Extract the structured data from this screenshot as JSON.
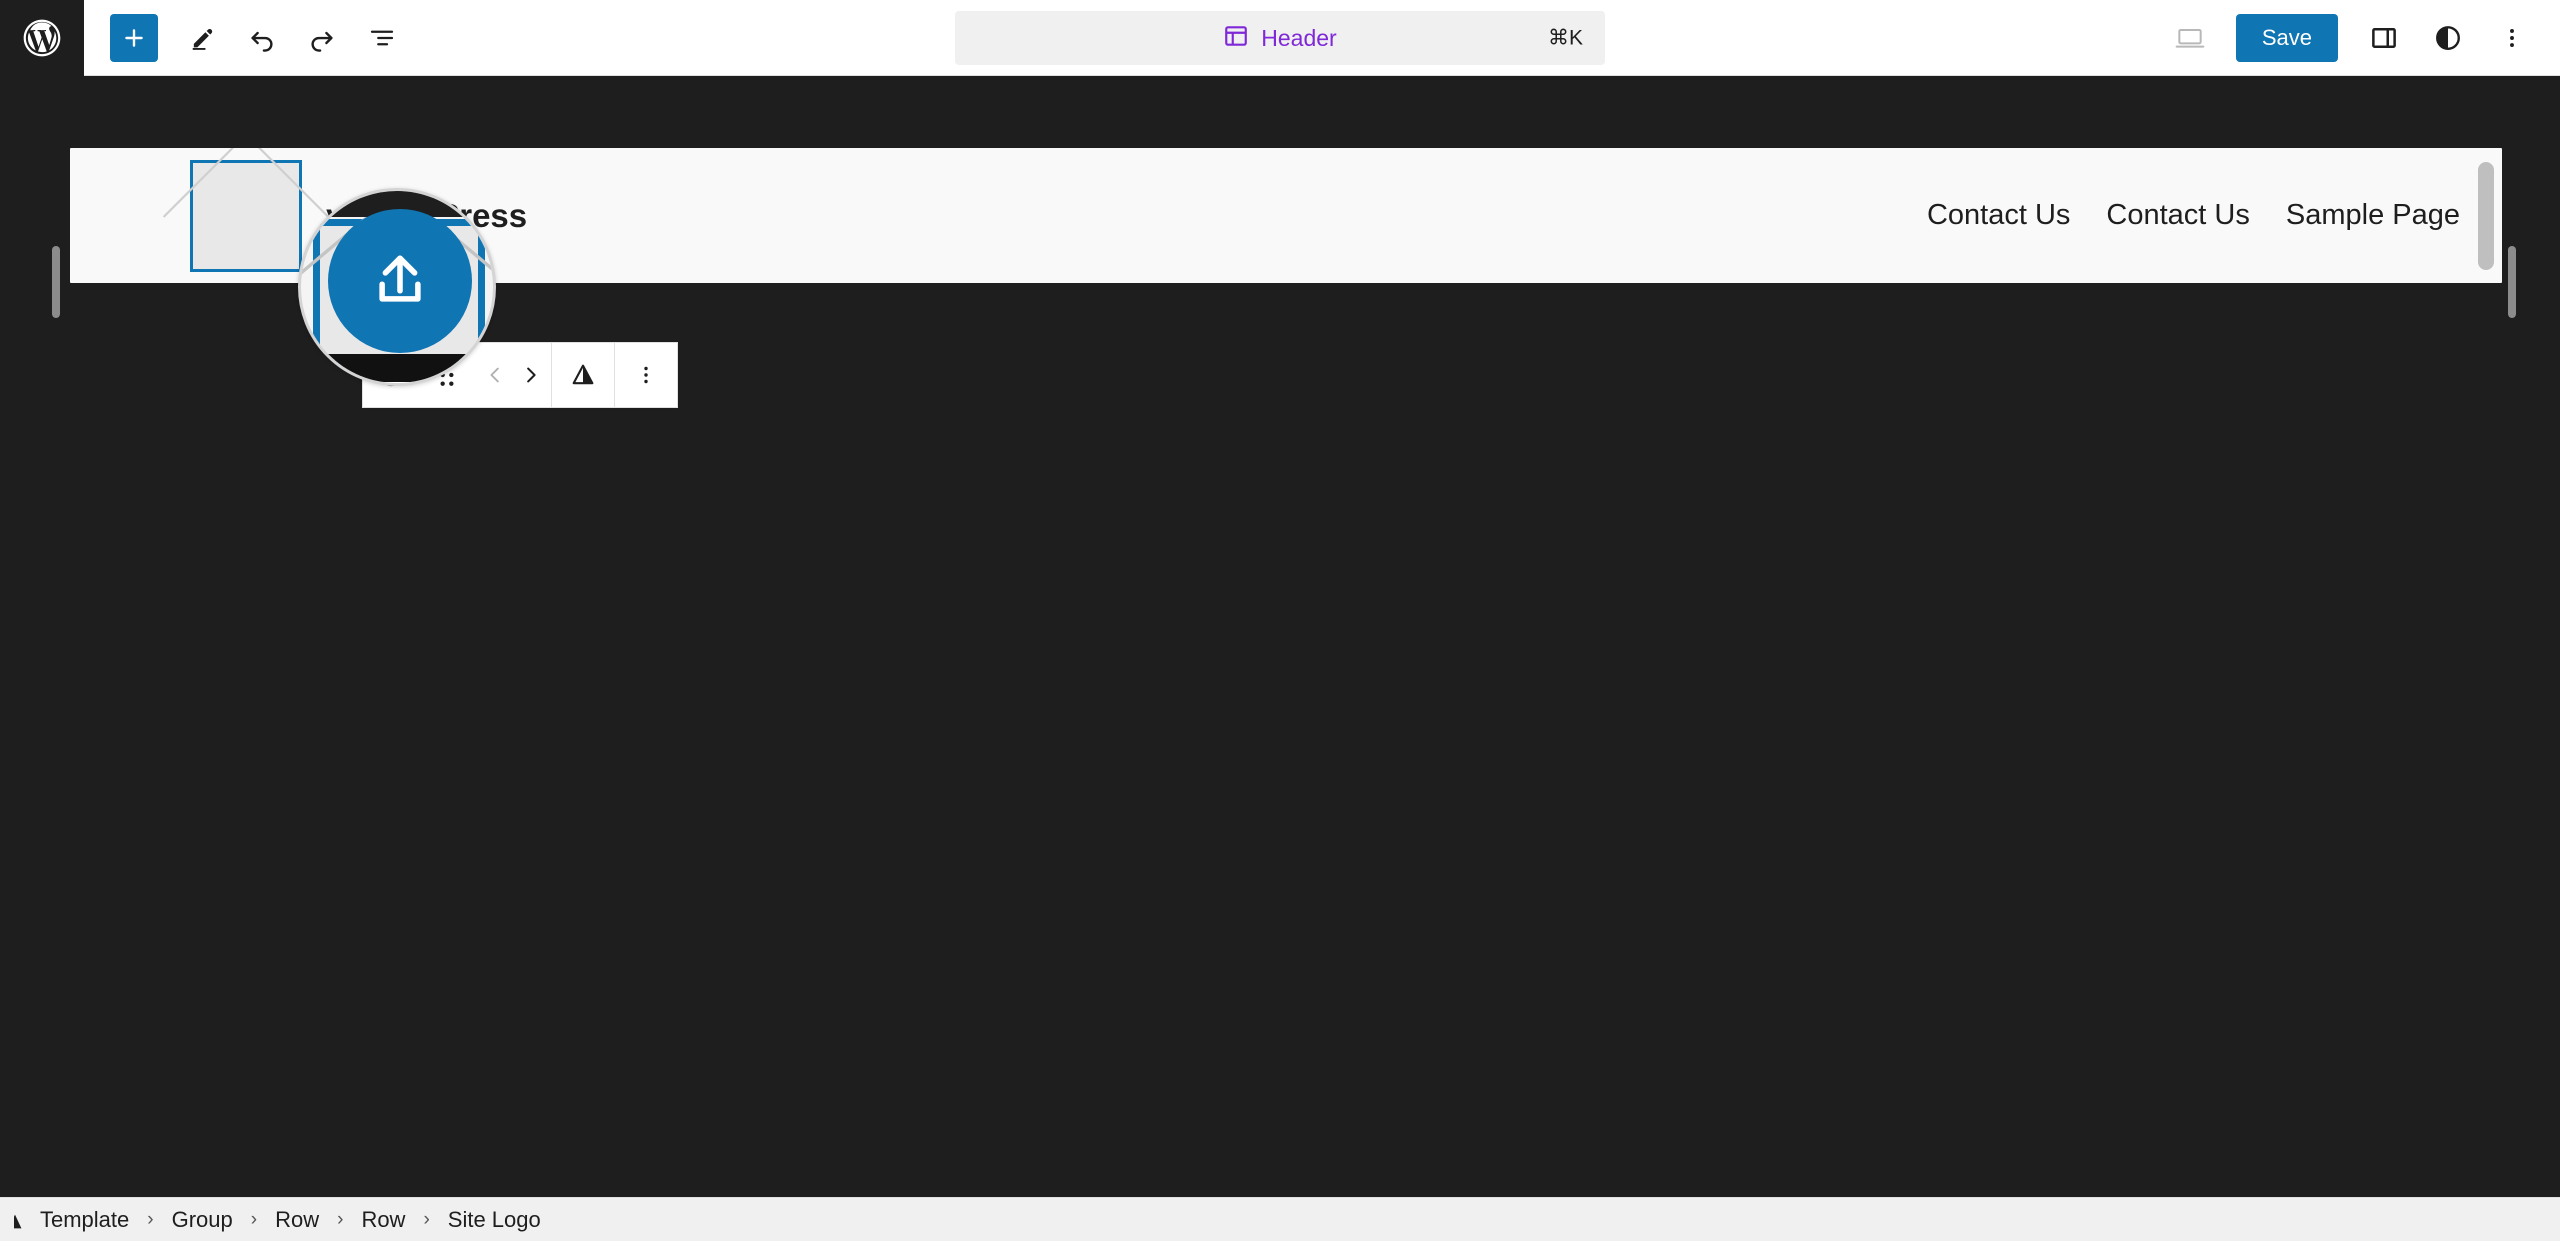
{
  "app": {
    "name": "WordPress Site Editor",
    "accent_blue": "#1075b3",
    "dark_bg": "#1e1e1e",
    "canvas_bg": "#f9f9f9",
    "command_purple": "#7f28d8"
  },
  "topbar": {
    "wp_logo_icon": "wordpress-logo-icon",
    "tools": [
      {
        "icon": "plus-icon",
        "name": "block-inserter-button",
        "label": "Add block"
      },
      {
        "icon": "pencil-icon",
        "name": "edit-tool-button",
        "label": "Edit"
      },
      {
        "icon": "undo-arrow-icon",
        "name": "undo-button",
        "label": "Undo"
      },
      {
        "icon": "redo-arrow-icon",
        "name": "redo-button",
        "label": "Redo"
      },
      {
        "icon": "list-view-icon",
        "name": "document-overview-button",
        "label": "Document Overview"
      }
    ],
    "command_bar": {
      "icon": "header-template-icon",
      "label": "Header",
      "shortcut": "⌘K"
    },
    "right_tools": [
      {
        "icon": "desktop-preview-icon",
        "name": "view-preview-button",
        "label": "View"
      }
    ],
    "save_label": "Save",
    "after_save_tools": [
      {
        "icon": "sidebar-panel-icon",
        "name": "settings-sidebar-button",
        "label": "Settings"
      },
      {
        "icon": "contrast-styles-icon",
        "name": "styles-button",
        "label": "Styles"
      },
      {
        "icon": "more-vertical-icon",
        "name": "options-menu-button",
        "label": "Options"
      }
    ]
  },
  "canvas": {
    "site_title": "y WordPress",
    "logo_placeholder_icon": "image-placeholder-icon",
    "nav_items": [
      {
        "label": "Contact Us"
      },
      {
        "label": "Contact Us"
      },
      {
        "label": "Sample Page"
      }
    ],
    "scrollbar_name": "canvas-vertical-scrollbar",
    "resize_handle_left": "canvas-resize-handle-left",
    "resize_handle_right": "canvas-resize-handle-right"
  },
  "block_toolbar": {
    "items": [
      {
        "icon": "site-logo-block-icon",
        "name": "block-type-button",
        "label": "Site Logo"
      },
      {
        "icon": "drag-handle-icon",
        "name": "drag-handle",
        "label": "Drag"
      },
      {
        "icon": "chevron-left-icon",
        "name": "move-left-button",
        "label": "Move left",
        "disabled": true
      },
      {
        "icon": "chevron-right-icon",
        "name": "move-right-button",
        "label": "Move right",
        "disabled": false
      },
      {
        "icon": "align-triangle-icon",
        "name": "align-button",
        "label": "Align"
      },
      {
        "icon": "more-vertical-icon",
        "name": "block-options-button",
        "label": "Options"
      }
    ]
  },
  "zoom_lens": {
    "upload_icon": "upload-arrow-icon",
    "name": "magnifier-lens"
  },
  "breadcrumb": {
    "items": [
      {
        "label": "Template"
      },
      {
        "label": "Group"
      },
      {
        "label": "Row"
      },
      {
        "label": "Row"
      },
      {
        "label": "Site Logo"
      }
    ],
    "separator": "›"
  }
}
